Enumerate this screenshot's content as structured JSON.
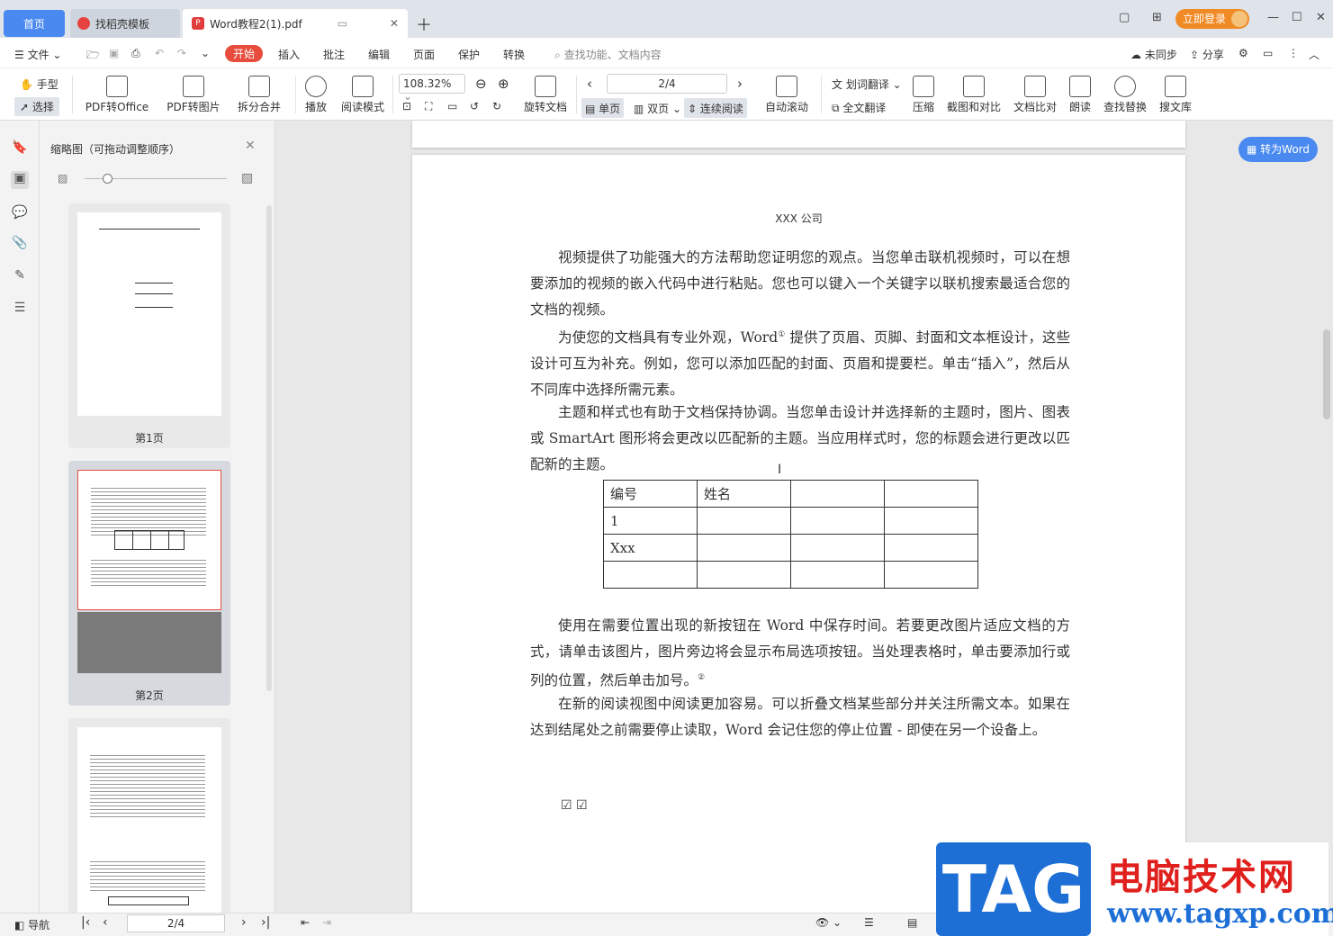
{
  "tabs": {
    "home": "首页",
    "template": "找稻壳模板",
    "document": "Word教程2(1).pdf"
  },
  "window": {
    "login": "立即登录"
  },
  "menu": {
    "file": "文件",
    "start": "开始",
    "insert": "插入",
    "annotate": "批注",
    "edit": "编辑",
    "page": "页面",
    "protect": "保护",
    "convert": "转换",
    "search_placeholder": "查找功能、文档内容",
    "sync": "未同步",
    "share": "分享"
  },
  "ribbon": {
    "hand": "手型",
    "select": "选择",
    "pdf_to_office": "PDF转Office",
    "pdf_to_image": "PDF转图片",
    "split_merge": "拆分合并",
    "play": "播放",
    "read_mode": "阅读模式",
    "zoom": "108.32%",
    "rotate": "旋转文档",
    "page_indicator": "2/4",
    "single": "单页",
    "double": "双页",
    "continuous": "连续阅读",
    "auto_scroll": "自动滚动",
    "word_translate": "划词翻译",
    "full_translate": "全文翻译",
    "compress": "压缩",
    "screenshot_compare": "截图和对比",
    "doc_compare": "文档比对",
    "read_aloud": "朗读",
    "find_replace": "查找替换",
    "search_lib": "搜文库"
  },
  "panel": {
    "title": "缩略图（可拖动调整顺序）",
    "pages": [
      "第1页",
      "第2页"
    ]
  },
  "convert_word": "转为Word",
  "document": {
    "header": "XXX 公司",
    "p1": "视频提供了功能强大的方法帮助您证明您的观点。当您单击联机视频时，可以在想要添加的视频的嵌入代码中进行粘贴。您也可以键入一个关键字以联机搜索最适合您的文档的视频。",
    "p2a": "为使您的文档具有专业外观，Word",
    "p2sup": "①",
    "p2b": " 提供了页眉、页脚、封面和文本框设计，这些设计可互为补充。例如，您可以添加匹配的封面、页眉和提要栏。单击“插入”，然后从不同库中选择所需元素。",
    "p3": "主题和样式也有助于文档保持协调。当您单击设计并选择新的主题时，图片、图表或 SmartArt 图形将会更改以匹配新的主题。当应用样式时，您的标题会进行更改以匹配新的主题。",
    "table": [
      [
        "编号",
        "姓名",
        "",
        ""
      ],
      [
        "1",
        "",
        "",
        ""
      ],
      [
        "Xxx",
        "",
        "",
        ""
      ],
      [
        "",
        "",
        "",
        ""
      ]
    ],
    "p4a": "使用在需要位置出现的新按钮在 Word 中保存时间。若要更改图片适应文档的方式，请单击该图片，图片旁边将会显示布局选项按钮。当处理表格时，单击要添加行或列的位置，然后单击加号。",
    "p4sup": "②",
    "p5": "在新的阅读视图中阅读更加容易。可以折叠文档某些部分并关注所需文本。如果在达到结尾处之前需要停止读取，Word 会记住您的停止位置 - 即使在另一个设备上。",
    "checks": "☑ ☑"
  },
  "status": {
    "nav": "导航",
    "page": "2/4"
  },
  "watermark": {
    "tag": "TAG",
    "title": "电脑技术网",
    "url": "www.tagxp.com"
  }
}
